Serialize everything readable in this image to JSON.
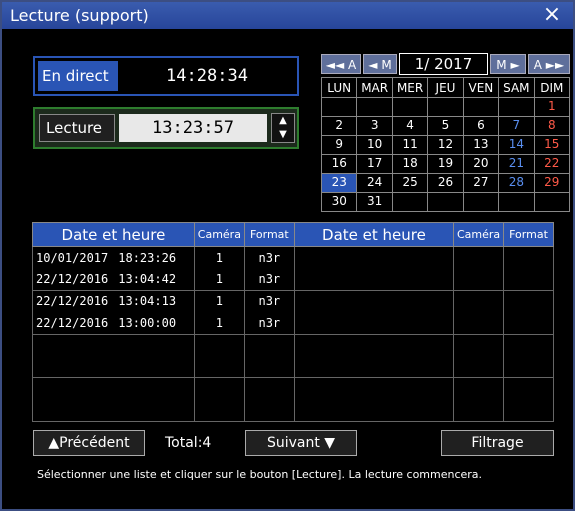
{
  "window": {
    "title": "Lecture (support)",
    "close_icon": "×"
  },
  "live": {
    "label": "En direct",
    "time": "14:28:34"
  },
  "playback": {
    "label": "Lecture",
    "time": "13:23:57",
    "up": "▲",
    "down": "▼"
  },
  "calendar": {
    "prev_year": "◄◄ A",
    "prev_month": "◄ M",
    "month_label": "1/ 2017",
    "next_month": "M ►",
    "next_year": "A ►►",
    "weekdays": [
      "LUN",
      "MAR",
      "MER",
      "JEU",
      "VEN",
      "SAM",
      "DIM"
    ],
    "weeks": [
      [
        "",
        "",
        "",
        "",
        "",
        "",
        "1"
      ],
      [
        "2",
        "3",
        "4",
        "5",
        "6",
        "7",
        "8"
      ],
      [
        "9",
        "10",
        "11",
        "12",
        "13",
        "14",
        "15"
      ],
      [
        "16",
        "17",
        "18",
        "19",
        "20",
        "21",
        "22"
      ],
      [
        "23",
        "24",
        "25",
        "26",
        "27",
        "28",
        "29"
      ],
      [
        "30",
        "31",
        "",
        "",
        "",
        "",
        ""
      ]
    ],
    "selected_day": "23",
    "colors": {
      "saturday": "#5a8ff0",
      "sunday": "#ff5a48",
      "selected": "#2a55b5"
    }
  },
  "list": {
    "headers": [
      "Date et heure",
      "Caméra",
      "Format",
      "Date et heure",
      "Caméra",
      "Format"
    ],
    "rows": [
      {
        "date": "10/01/2017",
        "time": "18:23:26",
        "camera": "1",
        "format": "n3r"
      },
      {
        "date": "22/12/2016",
        "time": "13:04:42",
        "camera": "1",
        "format": "n3r"
      },
      {
        "date": "22/12/2016",
        "time": "13:04:13",
        "camera": "1",
        "format": "n3r"
      },
      {
        "date": "22/12/2016",
        "time": "13:00:00",
        "camera": "1",
        "format": "n3r"
      }
    ]
  },
  "buttons": {
    "previous": "▲Précédent",
    "next": "Suivant ▼",
    "filter": "Filtrage"
  },
  "total_label": "Total:4",
  "footer": "Sélectionner une liste et cliquer sur le bouton [Lecture]. La lecture commencera."
}
